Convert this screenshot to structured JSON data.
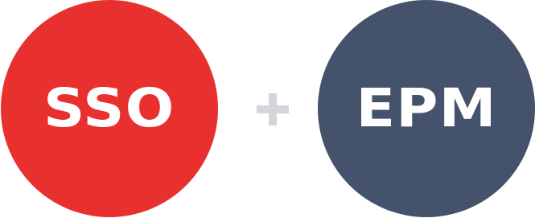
{
  "left_circle": {
    "label": "SSO",
    "color": "#e8312f"
  },
  "connector": {
    "icon": "plus-icon",
    "color": "#d3d5da"
  },
  "right_circle": {
    "label": "EPM",
    "color": "#44526c"
  }
}
